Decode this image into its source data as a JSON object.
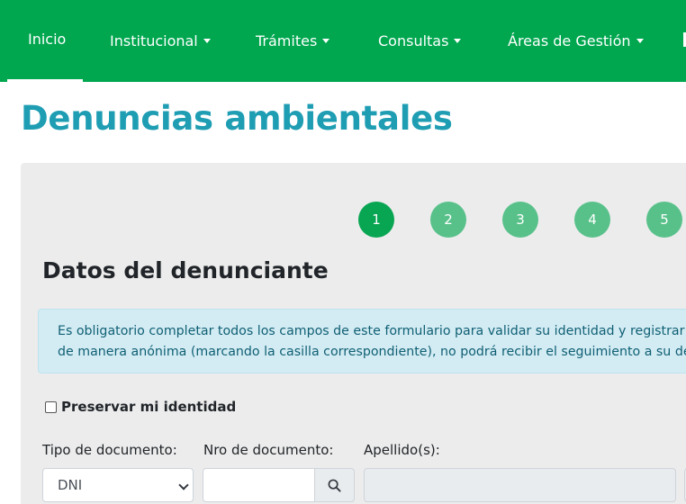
{
  "nav": {
    "items": [
      {
        "label": "Inicio",
        "active": true,
        "dropdown": false
      },
      {
        "label": "Institucional",
        "active": false,
        "dropdown": true
      },
      {
        "label": "Trámites",
        "active": false,
        "dropdown": true
      },
      {
        "label": "Consultas",
        "active": false,
        "dropdown": true
      },
      {
        "label": "Áreas de Gestión",
        "active": false,
        "dropdown": true
      }
    ]
  },
  "page": {
    "title": "Denuncias ambientales"
  },
  "wizard": {
    "steps": [
      "1",
      "2",
      "3",
      "4",
      "5"
    ],
    "current_step": 1
  },
  "form": {
    "section_title": "Datos del denunciante",
    "alert_lines": [
      "Es obligatorio completar todos los campos de este formulario para validar su identidad y registrar la",
      "de manera anónima (marcando la casilla correspondiente), no podrá recibir el seguimiento a su den"
    ],
    "preserve_identity": {
      "label": "Preservar mi identidad",
      "checked": false
    },
    "doc_type": {
      "label": "Tipo de documento:",
      "value": "DNI"
    },
    "doc_number": {
      "label": "Nro de documento:",
      "value": "",
      "placeholder": ""
    },
    "surname": {
      "label": "Apellido(s):",
      "value": ""
    }
  },
  "colors": {
    "navbar": "#00a74f",
    "title": "#1e9db3",
    "step_active": "#08a552",
    "step_inactive": "#58c18a",
    "alert_bg": "#d3ecf4",
    "alert_text": "#0f5f73",
    "panel_bg": "#ececec"
  },
  "icons": {
    "search": "search-icon",
    "dropdown": "caret-down-icon"
  }
}
